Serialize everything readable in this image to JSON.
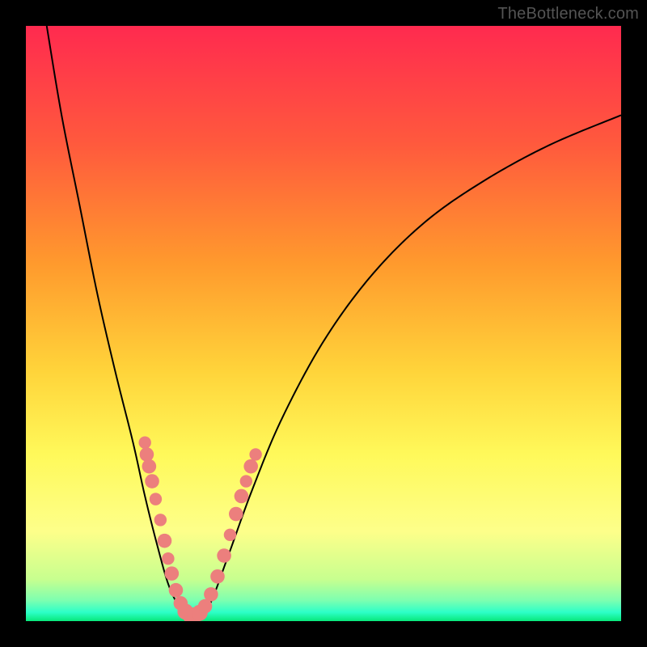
{
  "watermark": "TheBottleneck.com",
  "domain": "Chart",
  "chart_data": {
    "type": "line",
    "title": "",
    "xlabel": "",
    "ylabel": "",
    "xlim": [
      0,
      100
    ],
    "ylim": [
      0,
      100
    ],
    "background_gradient_stops": [
      {
        "offset": 0.0,
        "color": "#ff2a4f"
      },
      {
        "offset": 0.2,
        "color": "#ff5a3d"
      },
      {
        "offset": 0.4,
        "color": "#ff9a2d"
      },
      {
        "offset": 0.58,
        "color": "#ffd43a"
      },
      {
        "offset": 0.72,
        "color": "#fff95a"
      },
      {
        "offset": 0.85,
        "color": "#fdff8a"
      },
      {
        "offset": 0.93,
        "color": "#c7ff8f"
      },
      {
        "offset": 0.965,
        "color": "#7dffb0"
      },
      {
        "offset": 0.985,
        "color": "#2dffc8"
      },
      {
        "offset": 1.0,
        "color": "#08e87a"
      }
    ],
    "series": [
      {
        "name": "bottleneck-curve",
        "color": "#000000",
        "points": [
          {
            "x": 3.5,
            "y": 100
          },
          {
            "x": 6,
            "y": 85
          },
          {
            "x": 9,
            "y": 70
          },
          {
            "x": 12,
            "y": 55
          },
          {
            "x": 15,
            "y": 42
          },
          {
            "x": 18,
            "y": 30
          },
          {
            "x": 20,
            "y": 21
          },
          {
            "x": 22,
            "y": 13
          },
          {
            "x": 24,
            "y": 6
          },
          {
            "x": 26,
            "y": 2
          },
          {
            "x": 27.5,
            "y": 0.5
          },
          {
            "x": 29,
            "y": 0.5
          },
          {
            "x": 31,
            "y": 3
          },
          {
            "x": 34,
            "y": 11
          },
          {
            "x": 38,
            "y": 22
          },
          {
            "x": 43,
            "y": 34
          },
          {
            "x": 50,
            "y": 47
          },
          {
            "x": 58,
            "y": 58
          },
          {
            "x": 67,
            "y": 67
          },
          {
            "x": 77,
            "y": 74
          },
          {
            "x": 88,
            "y": 80
          },
          {
            "x": 100,
            "y": 85
          }
        ]
      }
    ],
    "markers": {
      "name": "highlight-dots",
      "color": "#ec7f7d",
      "points": [
        {
          "x": 20.0,
          "y": 30,
          "r": 3.5
        },
        {
          "x": 20.3,
          "y": 28,
          "r": 4
        },
        {
          "x": 20.7,
          "y": 26,
          "r": 4
        },
        {
          "x": 21.2,
          "y": 23.5,
          "r": 4
        },
        {
          "x": 21.8,
          "y": 20.5,
          "r": 3.5
        },
        {
          "x": 22.6,
          "y": 17,
          "r": 3.5
        },
        {
          "x": 23.3,
          "y": 13.5,
          "r": 4
        },
        {
          "x": 23.9,
          "y": 10.5,
          "r": 3.5
        },
        {
          "x": 24.5,
          "y": 8,
          "r": 4
        },
        {
          "x": 25.2,
          "y": 5.2,
          "r": 4
        },
        {
          "x": 26.0,
          "y": 3.0,
          "r": 4
        },
        {
          "x": 26.8,
          "y": 1.6,
          "r": 4.5
        },
        {
          "x": 27.6,
          "y": 1.0,
          "r": 4.5
        },
        {
          "x": 28.4,
          "y": 1.0,
          "r": 4.5
        },
        {
          "x": 29.2,
          "y": 1.4,
          "r": 4.5
        },
        {
          "x": 30.1,
          "y": 2.5,
          "r": 4
        },
        {
          "x": 31.1,
          "y": 4.5,
          "r": 4
        },
        {
          "x": 32.2,
          "y": 7.5,
          "r": 4
        },
        {
          "x": 33.3,
          "y": 11.0,
          "r": 4
        },
        {
          "x": 34.3,
          "y": 14.5,
          "r": 3.5
        },
        {
          "x": 35.3,
          "y": 18.0,
          "r": 4
        },
        {
          "x": 36.2,
          "y": 21.0,
          "r": 4
        },
        {
          "x": 37.0,
          "y": 23.5,
          "r": 3.5
        },
        {
          "x": 37.8,
          "y": 26.0,
          "r": 4
        },
        {
          "x": 38.6,
          "y": 28.0,
          "r": 3.5
        }
      ]
    }
  }
}
